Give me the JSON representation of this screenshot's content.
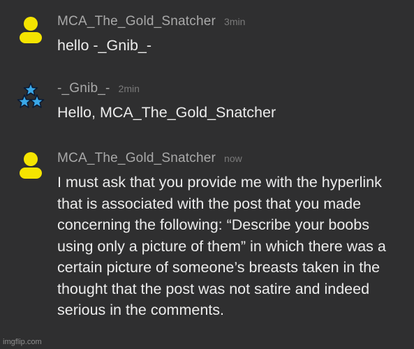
{
  "colors": {
    "background": "#2f2f30",
    "username": "#a9a9a9",
    "timestamp": "#7a7a7a",
    "message_text": "#ececec",
    "avatar_yellow": "#f5e400",
    "avatar_star_blue": "#3aa8e8"
  },
  "messages": [
    {
      "avatar_icon": "yellow-person-avatar-icon",
      "username": "MCA_The_Gold_Snatcher",
      "timestamp": "3min",
      "text": "hello -_Gnib_-"
    },
    {
      "avatar_icon": "three-blue-stars-avatar-icon",
      "username": "-_Gnib_-",
      "timestamp": "2min",
      "text": "Hello, MCA_The_Gold_Snatcher"
    },
    {
      "avatar_icon": "yellow-person-avatar-icon",
      "username": "MCA_The_Gold_Snatcher",
      "timestamp": "now",
      "text": "I must ask that you provide me with the hyperlink that is associated with the post that you made concerning the following: “Describe your boobs using only a picture of them” in which there was a certain picture of someone’s breasts taken in the thought that the post was not satire and indeed serious in the comments."
    }
  ],
  "watermark": "imgflip.com"
}
